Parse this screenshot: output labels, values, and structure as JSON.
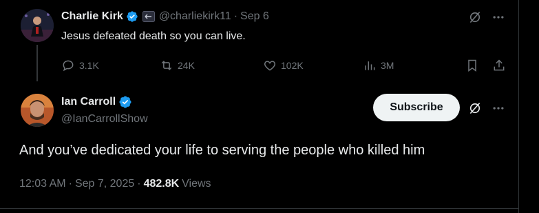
{
  "original_tweet": {
    "author_name": "Charlie Kirk",
    "handle": "@charliekirk11",
    "separator": "·",
    "date": "Sep 6",
    "text": "Jesus defeated death so you can live.",
    "stats": {
      "replies": "3.1K",
      "reposts": "24K",
      "likes": "102K",
      "views": "3M"
    }
  },
  "reply_tweet": {
    "author_name": "Ian Carroll",
    "handle": "@IanCarrollShow",
    "subscribe_label": "Subscribe",
    "text": "And you’ve dedicated your life to serving the people who killed him",
    "time": "12:03 AM",
    "separator": "·",
    "date": "Sep 7, 2025",
    "views_count": "482.8K",
    "views_label": "Views"
  },
  "colors": {
    "background": "#000000",
    "text": "#e7e9ea",
    "muted": "#71767b",
    "verified": "#1d9bf0",
    "subscribe_bg": "#eff3f4"
  }
}
